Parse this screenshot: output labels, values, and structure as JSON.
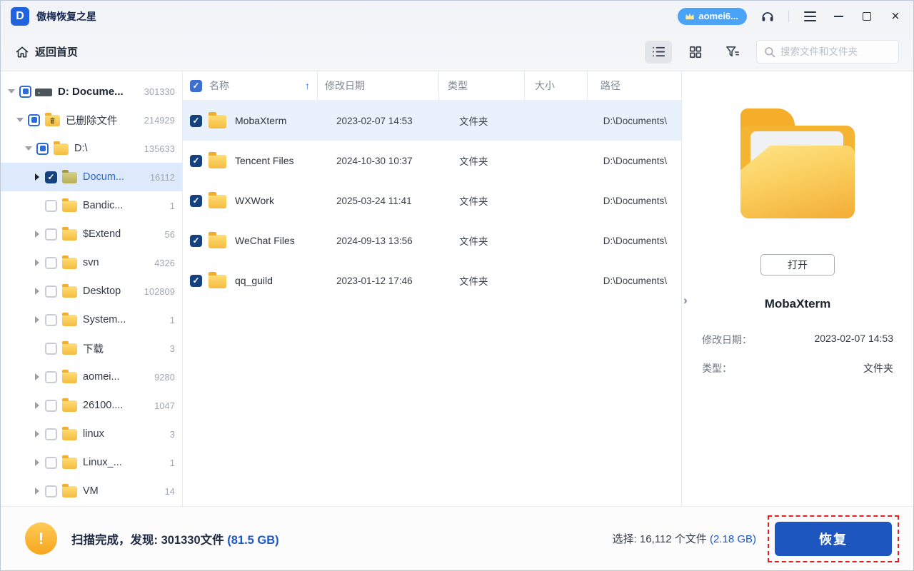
{
  "titlebar": {
    "app_title": "傲梅恢复之星",
    "logo_letter": "D",
    "user_badge": "aomei6...",
    "minimize": "─",
    "close": "×"
  },
  "toolbar": {
    "back_home": "返回首页",
    "search_placeholder": "搜索文件和文件夹"
  },
  "sidebar": {
    "items": [
      {
        "label": "D: Docume...",
        "count": "301330",
        "level": 0,
        "icon": "drive",
        "checkbox": "indeterminate",
        "expanded": true
      },
      {
        "label": "已删除文件",
        "count": "214929",
        "level": 1,
        "icon": "trash-folder",
        "checkbox": "indeterminate",
        "expanded": true
      },
      {
        "label": "D:\\",
        "count": "135633",
        "level": 2,
        "icon": "folder",
        "checkbox": "indeterminate",
        "expanded": true
      },
      {
        "label": "Docum...",
        "count": "16112",
        "level": 3,
        "icon": "folder",
        "checkbox": "checked",
        "selected": true
      },
      {
        "label": "Bandic...",
        "count": "1",
        "level": 3,
        "icon": "folder",
        "checkbox": "unchecked"
      },
      {
        "label": "$Extend",
        "count": "56",
        "level": 3,
        "icon": "folder",
        "checkbox": "unchecked"
      },
      {
        "label": "svn",
        "count": "4326",
        "level": 3,
        "icon": "folder",
        "checkbox": "unchecked"
      },
      {
        "label": "Desktop",
        "count": "102809",
        "level": 3,
        "icon": "folder",
        "checkbox": "unchecked"
      },
      {
        "label": "System...",
        "count": "1",
        "level": 3,
        "icon": "folder",
        "checkbox": "unchecked"
      },
      {
        "label": "下载",
        "count": "3",
        "level": 3,
        "icon": "folder",
        "checkbox": "unchecked"
      },
      {
        "label": "aomei...",
        "count": "9280",
        "level": 3,
        "icon": "folder",
        "checkbox": "unchecked"
      },
      {
        "label": "26100....",
        "count": "1047",
        "level": 3,
        "icon": "folder",
        "checkbox": "unchecked"
      },
      {
        "label": "linux",
        "count": "3",
        "level": 3,
        "icon": "folder",
        "checkbox": "unchecked"
      },
      {
        "label": "Linux_...",
        "count": "1",
        "level": 3,
        "icon": "folder",
        "checkbox": "unchecked"
      },
      {
        "label": "VM",
        "count": "14",
        "level": 3,
        "icon": "folder",
        "checkbox": "unchecked"
      }
    ]
  },
  "table": {
    "columns": {
      "name": "名称",
      "date": "修改日期",
      "type": "类型",
      "size": "大小",
      "path": "路径"
    },
    "sort_arrow": "↑",
    "rows": [
      {
        "name": "MobaXterm",
        "date": "2023-02-07 14:53",
        "type": "文件夹",
        "size": "",
        "path": "D:\\Documents\\",
        "checked": true
      },
      {
        "name": "Tencent Files",
        "date": "2024-10-30 10:37",
        "type": "文件夹",
        "size": "",
        "path": "D:\\Documents\\",
        "checked": true
      },
      {
        "name": "WXWork",
        "date": "2025-03-24 11:41",
        "type": "文件夹",
        "size": "",
        "path": "D:\\Documents\\",
        "checked": true
      },
      {
        "name": "WeChat Files",
        "date": "2024-09-13 13:56",
        "type": "文件夹",
        "size": "",
        "path": "D:\\Documents\\",
        "checked": true
      },
      {
        "name": "qq_guild",
        "date": "2023-01-12 17:46",
        "type": "文件夹",
        "size": "",
        "path": "D:\\Documents\\",
        "checked": true
      }
    ]
  },
  "preview": {
    "collapse_chevron": "›",
    "open_button": "打开",
    "title": "MobaXterm",
    "details": [
      {
        "label": "修改日期：",
        "value": "2023-02-07 14:53"
      },
      {
        "label": "类型：",
        "value": "文件夹"
      }
    ]
  },
  "footer": {
    "warn_mark": "!",
    "scan_text": "扫描完成，发现: 301330文件 ",
    "scan_size": "(81.5 GB)",
    "selection_text": "选择: 16,112 个文件 ",
    "selection_size": "(2.18 GB)",
    "recover_label": "恢复"
  },
  "colors": {
    "accent_blue": "#2e6bd6",
    "checked_navy": "#16417f",
    "selected_row_bg": "#dceafb",
    "table_selected_bg": "#e9f2fc",
    "button_blue": "#1e56c0",
    "stat_blue": "#1b57c8",
    "badge_blue": "#4aa3f7",
    "warn_orange": "#f6a61e",
    "highlight_red_dashed": "#e02222",
    "folder_yellow": "#f6bb41"
  }
}
